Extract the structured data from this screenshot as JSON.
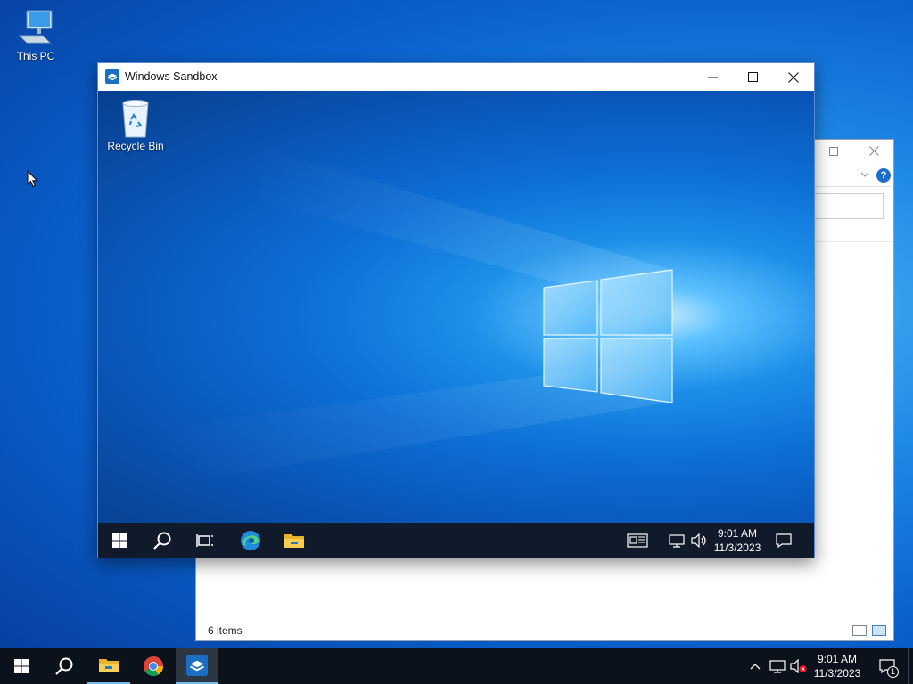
{
  "desktop": {
    "icons": [
      {
        "label": "This PC",
        "icon": "computer-icon"
      }
    ]
  },
  "explorer_window": {
    "status_text": "6 items",
    "help_label": "?"
  },
  "sandbox_window": {
    "title": "Windows Sandbox",
    "controls": {
      "minimize": "minimize-icon",
      "maximize": "maximize-icon",
      "close": "close-icon"
    },
    "desktop_icons": [
      {
        "label": "Recycle Bin",
        "icon": "recycle-bin-icon"
      }
    ],
    "taskbar": {
      "clock_time": "9:01 AM",
      "clock_date": "11/3/2023",
      "items": [
        "start-icon",
        "search-icon",
        "task-view-icon",
        "edge-icon",
        "file-explorer-icon"
      ],
      "tray": [
        "news-icon",
        "network-icon",
        "volume-icon",
        "notifications-icon"
      ]
    }
  },
  "taskbar": {
    "clock_time": "9:01 AM",
    "clock_date": "11/3/2023",
    "notification_count": "1",
    "items": [
      "start-icon",
      "search-icon",
      "file-explorer-icon",
      "chrome-icon",
      "windows-sandbox-icon"
    ],
    "tray": [
      "chevron-up-icon",
      "network-icon",
      "volume-muted-icon",
      "notifications-icon"
    ]
  },
  "colors": {
    "accent": "#0a62cf",
    "taskbar": "#0c121b",
    "sandbox_taskbar": "#101a2a",
    "active_indicator": "#76b9ed"
  }
}
